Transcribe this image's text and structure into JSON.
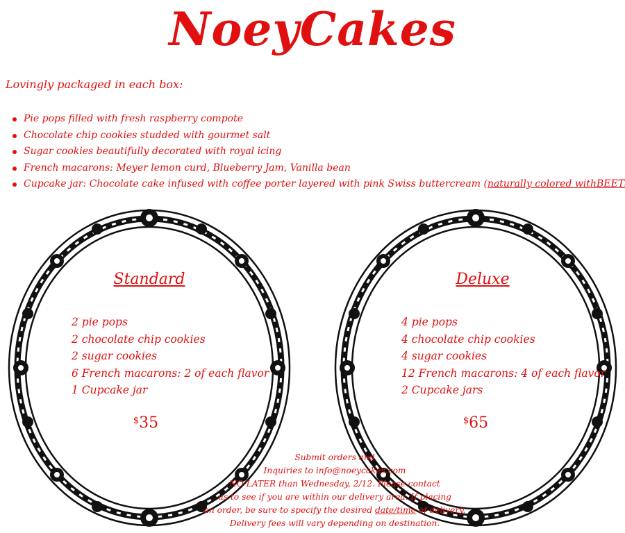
{
  "brand": {
    "title": "NoeyCakes",
    "color": "#e01010"
  },
  "intro": "Lovingly packaged in each box:",
  "box_items": [
    "Pie pops filled with fresh raspberry compote",
    "Chocolate chip cookies studded with gourmet salt",
    "Sugar cookies beautifully decorated with royal icing",
    "French macarons: Meyer lemon curd, Blueberry Jam, Vanilla bean"
  ],
  "cupcake_item": {
    "text": "Cupcake jar: Chocolate cake infused with coffee porter layered with pink Swiss buttercream ",
    "paren_open": "(",
    "link": "naturally colored withBEETS!",
    "paren_close": ")"
  },
  "packages": {
    "standard": {
      "name": "Standard",
      "items": [
        "2 pie pops",
        "2 chocolate chip cookies",
        "2 sugar cookies",
        "6 French macarons: 2 of each flavor",
        "1 Cupcake jar"
      ],
      "currency": "$",
      "price": "35"
    },
    "deluxe": {
      "name": "Deluxe",
      "items": [
        "4 pie pops",
        "4 chocolate chip cookies",
        "4 sugar cookies",
        "12 French macarons: 4 of each flavor",
        "2 Cupcake jars"
      ],
      "currency": "$",
      "price": "65"
    }
  },
  "footer": {
    "line1": "Submit orders and",
    "line2": "Inquiries to info@noeycakes.com",
    "line3": "NO LATER than Wednesday, 2/12. Please contact",
    "line4": "us to see if you are within our delivery area. If placing",
    "line5_pre": "an order, be sure to specify the desired ",
    "line5_u": "date/time",
    "line5_post": " of delivery.",
    "line6": "Delivery fees will vary depending on destination."
  }
}
